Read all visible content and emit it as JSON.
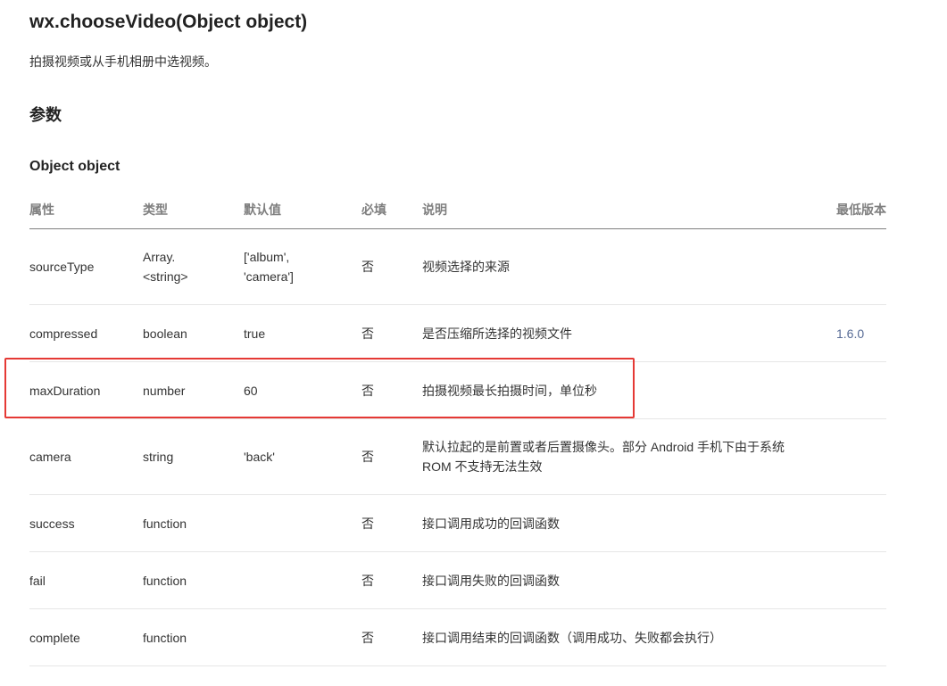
{
  "title": "wx.chooseVideo(Object object)",
  "description": "拍摄视频或从手机相册中选视频。",
  "section_params": "参数",
  "section_object": "Object object",
  "table": {
    "headers": [
      "属性",
      "类型",
      "默认值",
      "必填",
      "说明",
      "最低版本"
    ],
    "rows": [
      {
        "name": "sourceType",
        "type_line1": "Array.",
        "type_line2": "<string>",
        "default_line1": "['album',",
        "default_line2": "'camera']",
        "required": "否",
        "desc_line1": "视频选择的来源",
        "desc_line2": "",
        "version": ""
      },
      {
        "name": "compressed",
        "type_line1": "boolean",
        "type_line2": "",
        "default_line1": "true",
        "default_line2": "",
        "required": "否",
        "desc_line1": "是否压缩所选择的视频文件",
        "desc_line2": "",
        "version": "1.6.0"
      },
      {
        "name": "maxDuration",
        "type_line1": "number",
        "type_line2": "",
        "default_line1": "60",
        "default_line2": "",
        "required": "否",
        "desc_line1": "拍摄视频最长拍摄时间，单位秒",
        "desc_line2": "",
        "version": ""
      },
      {
        "name": "camera",
        "type_line1": "string",
        "type_line2": "",
        "default_line1": "'back'",
        "default_line2": "",
        "required": "否",
        "desc_line1": "默认拉起的是前置或者后置摄像头。部分 Android 手机下由于系统",
        "desc_line2": "ROM 不支持无法生效",
        "version": ""
      },
      {
        "name": "success",
        "type_line1": "function",
        "type_line2": "",
        "default_line1": "",
        "default_line2": "",
        "required": "否",
        "desc_line1": "接口调用成功的回调函数",
        "desc_line2": "",
        "version": ""
      },
      {
        "name": "fail",
        "type_line1": "function",
        "type_line2": "",
        "default_line1": "",
        "default_line2": "",
        "required": "否",
        "desc_line1": "接口调用失败的回调函数",
        "desc_line2": "",
        "version": ""
      },
      {
        "name": "complete",
        "type_line1": "function",
        "type_line2": "",
        "default_line1": "",
        "default_line2": "",
        "required": "否",
        "desc_line1": "接口调用结束的回调函数（调用成功、失败都会执行）",
        "desc_line2": "",
        "version": ""
      }
    ]
  },
  "highlight_color": "#e53935",
  "version_link_color": "#576b95"
}
